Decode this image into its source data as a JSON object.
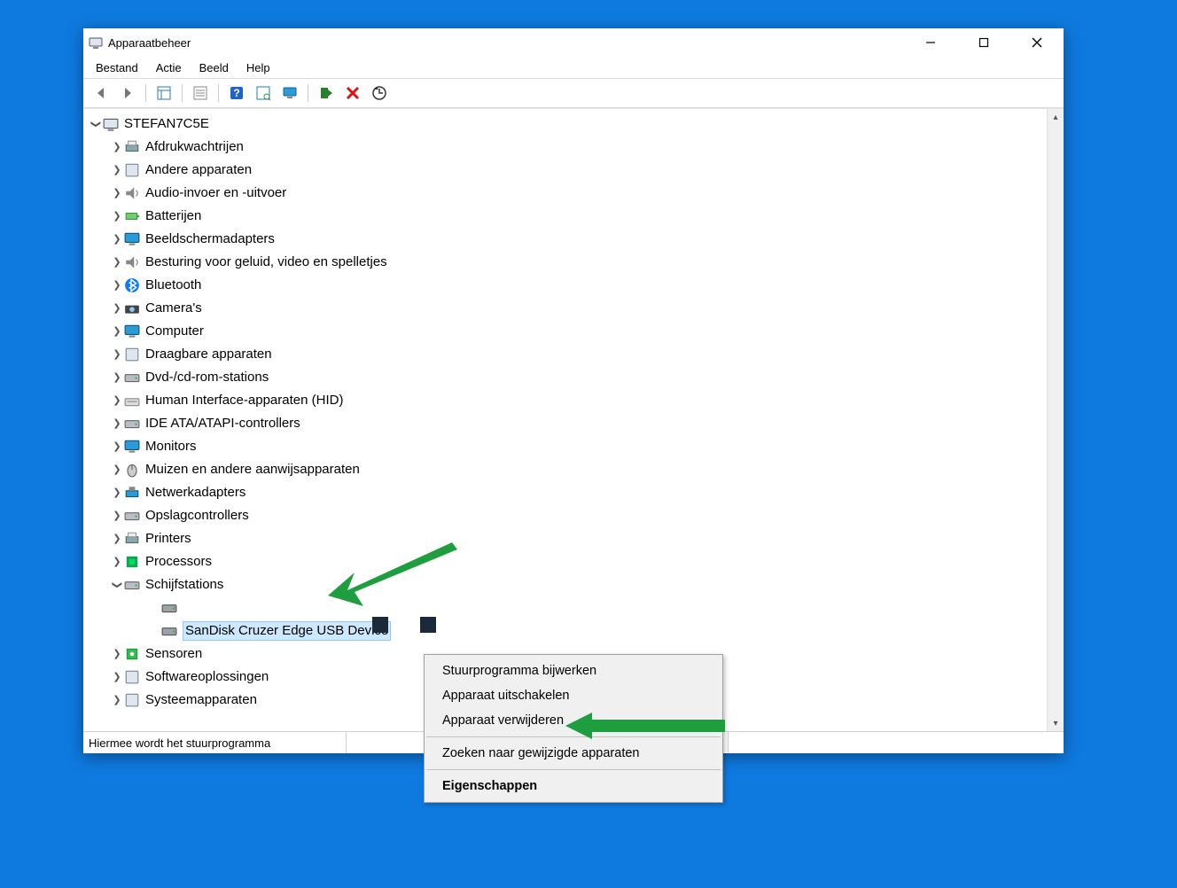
{
  "window": {
    "title": "Apparaatbeheer"
  },
  "menu": {
    "items": [
      "Bestand",
      "Actie",
      "Beeld",
      "Help"
    ]
  },
  "toolbar": {
    "buttons": [
      {
        "name": "back-icon"
      },
      {
        "name": "forward-icon"
      },
      {
        "name": "sep"
      },
      {
        "name": "show-hide-tree-icon"
      },
      {
        "name": "sep"
      },
      {
        "name": "properties-list-icon"
      },
      {
        "name": "sep"
      },
      {
        "name": "help-icon"
      },
      {
        "name": "scan-hardware-icon"
      },
      {
        "name": "monitor-icon"
      },
      {
        "name": "sep"
      },
      {
        "name": "enable-device-icon"
      },
      {
        "name": "uninstall-device-icon"
      },
      {
        "name": "update-driver-icon"
      }
    ]
  },
  "tree": {
    "root": "STEFAN7C5E",
    "categories": [
      {
        "label": "Afdrukwachtrijen",
        "expanded": false
      },
      {
        "label": "Andere apparaten",
        "expanded": false
      },
      {
        "label": "Audio-invoer en -uitvoer",
        "expanded": false
      },
      {
        "label": "Batterijen",
        "expanded": false
      },
      {
        "label": "Beeldschermadapters",
        "expanded": false
      },
      {
        "label": "Besturing voor geluid, video en spelletjes",
        "expanded": false
      },
      {
        "label": "Bluetooth",
        "expanded": false
      },
      {
        "label": "Camera's",
        "expanded": false
      },
      {
        "label": "Computer",
        "expanded": false
      },
      {
        "label": "Draagbare apparaten",
        "expanded": false
      },
      {
        "label": "Dvd-/cd-rom-stations",
        "expanded": false
      },
      {
        "label": "Human Interface-apparaten (HID)",
        "expanded": false
      },
      {
        "label": "IDE ATA/ATAPI-controllers",
        "expanded": false
      },
      {
        "label": "Monitors",
        "expanded": false
      },
      {
        "label": "Muizen en andere aanwijsapparaten",
        "expanded": false
      },
      {
        "label": "Netwerkadapters",
        "expanded": false
      },
      {
        "label": "Opslagcontrollers",
        "expanded": false
      },
      {
        "label": "Printers",
        "expanded": false
      },
      {
        "label": "Processors",
        "expanded": false
      },
      {
        "label": "Schijfstations",
        "expanded": true,
        "children": [
          {
            "label": ""
          },
          {
            "label": "SanDisk Cruzer Edge USB Device",
            "selected": true
          }
        ]
      },
      {
        "label": "Sensoren",
        "expanded": false
      },
      {
        "label": "Softwareoplossingen",
        "expanded": false
      },
      {
        "label": "Systeemapparaten",
        "expanded": false
      }
    ]
  },
  "context_menu": {
    "items": [
      {
        "label": "Stuurprogramma bijwerken"
      },
      {
        "label": "Apparaat uitschakelen"
      },
      {
        "label": "Apparaat verwijderen"
      },
      {
        "sep": true
      },
      {
        "label": "Zoeken naar gewijzigde apparaten"
      },
      {
        "sep": true
      },
      {
        "label": "Eigenschappen",
        "bold": true
      }
    ]
  },
  "statusbar": {
    "text": "Hiermee wordt het stuurprogramma"
  },
  "annotations": {
    "arrow_color": "#1e9e3e"
  }
}
